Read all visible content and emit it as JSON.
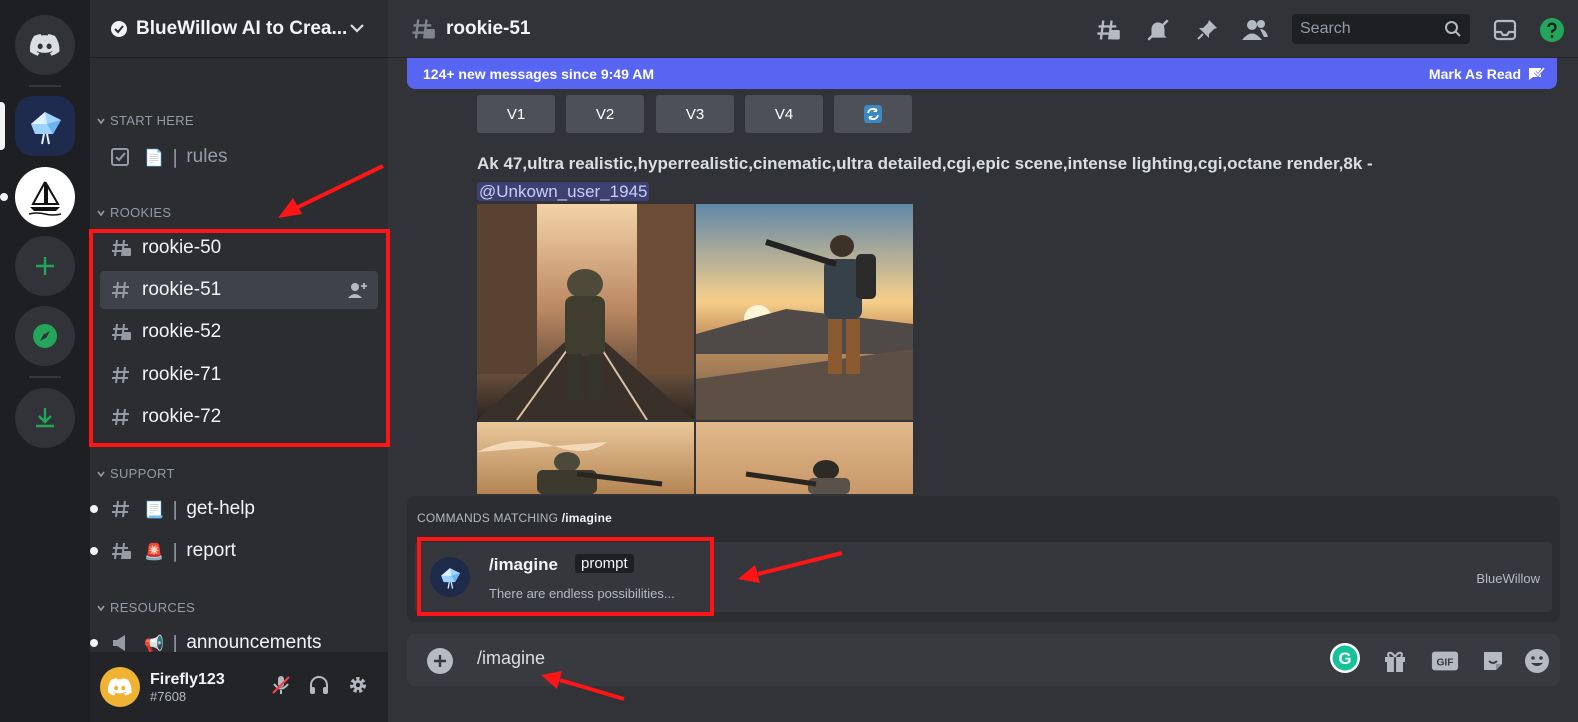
{
  "app": {
    "name": "Discord"
  },
  "servers": [
    {
      "name": "Discord Home",
      "icon": "discord-logo-icon"
    },
    {
      "name": "BlueWillow",
      "icon": "bluewillow-logo-icon"
    },
    {
      "name": "Midjourney",
      "icon": "sailboat-logo-icon"
    },
    {
      "name": "Add a Server",
      "icon": "plus-icon"
    },
    {
      "name": "Explore",
      "icon": "compass-icon"
    },
    {
      "name": "Download Apps",
      "icon": "download-icon"
    }
  ],
  "guild": {
    "name": "BlueWillow AI to Crea..."
  },
  "categories": {
    "start_here": "START HERE",
    "rookies": "ROOKIES",
    "support": "SUPPORT",
    "resources": "RESOURCES"
  },
  "channels": {
    "rules": "rules",
    "rookie_50": "rookie-50",
    "rookie_51": "rookie-51",
    "rookie_52": "rookie-52",
    "rookie_71": "rookie-71",
    "rookie_72": "rookie-72",
    "get_help": "get-help",
    "report": "report",
    "announcements": "announcements"
  },
  "user": {
    "name": "Firefly123",
    "tag": "#7608"
  },
  "channel_header": {
    "name": "rookie-51",
    "search_placeholder": "Search"
  },
  "new_messages": {
    "text": "124+ new messages since 9:49 AM",
    "mark_read": "Mark As Read"
  },
  "variation_buttons": [
    "V1",
    "V2",
    "V3",
    "V4"
  ],
  "message": {
    "prompt": "Ak 47,ultra realistic,hyperrealistic,cinematic,ultra detailed,cgi,epic scene,intense lighting,cgi,octane render,8k -",
    "mention": "@Unkown_user_1945"
  },
  "commands": {
    "header_prefix": "COMMANDS MATCHING",
    "header_query": "/imagine",
    "items": [
      {
        "name": "/imagine",
        "option": "prompt",
        "description": "There are endless possibilities...",
        "source": "BlueWillow"
      }
    ]
  },
  "composer": {
    "value": "/imagine",
    "gif_label": "GIF",
    "grammarly_label": "G"
  },
  "colors": {
    "blurple": "#5865f2",
    "annotation_red": "#ff1515",
    "green": "#23a55a"
  }
}
